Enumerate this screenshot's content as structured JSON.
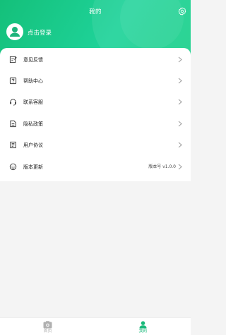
{
  "header": {
    "title": "我的",
    "login_label": "点击登录"
  },
  "menu": [
    {
      "label": "意见反馈",
      "icon": "feedback-icon"
    },
    {
      "label": "帮助中心",
      "icon": "help-icon"
    },
    {
      "label": "联系客服",
      "icon": "headset-icon"
    },
    {
      "label": "隐私政策",
      "icon": "privacy-doc-icon"
    },
    {
      "label": "用户协议",
      "icon": "agreement-doc-icon"
    },
    {
      "label": "版本更新",
      "icon": "update-icon",
      "value": "版本号 v1.0.0"
    }
  ],
  "tabbar": {
    "home_label": "首页",
    "mine_label": "我的"
  },
  "colors": {
    "accent": "#1ccb8a",
    "active_tab": "#19b97a",
    "inactive_tab": "#b0b0b0"
  }
}
